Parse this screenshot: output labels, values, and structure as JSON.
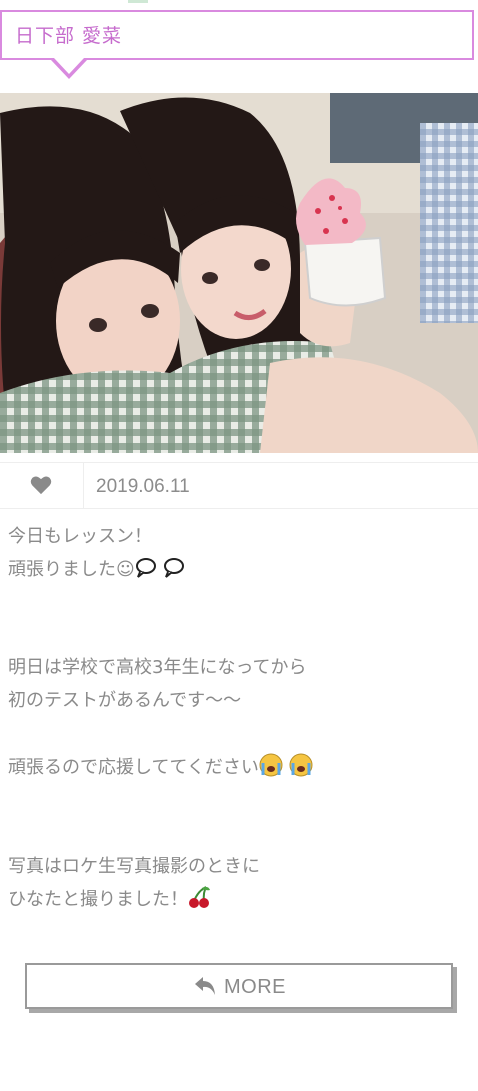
{
  "header": {
    "name": "日下部 愛菜"
  },
  "post": {
    "date": "2019.06.11",
    "lines": [
      "今日もレッスン！",
      "頑張りました☺",
      "明日は学校で高校3年生になってから",
      "初のテストがあるんです〜〜",
      "頑張るので応援しててください",
      "写真はロケ生写真撮影のときに",
      "ひなたと撮りました！"
    ]
  },
  "icons": {
    "like": "heart-icon",
    "more": "reply-arrow-icon",
    "emoji_1": "thought-bubble-emoji",
    "emoji_2": "crying-face-emoji",
    "emoji_3": "cherries-emoji"
  },
  "more_button": {
    "label": "MORE"
  },
  "colors": {
    "accent": "#d98adf",
    "name_text": "#c66ccd",
    "body_text": "#8a8a8a"
  }
}
